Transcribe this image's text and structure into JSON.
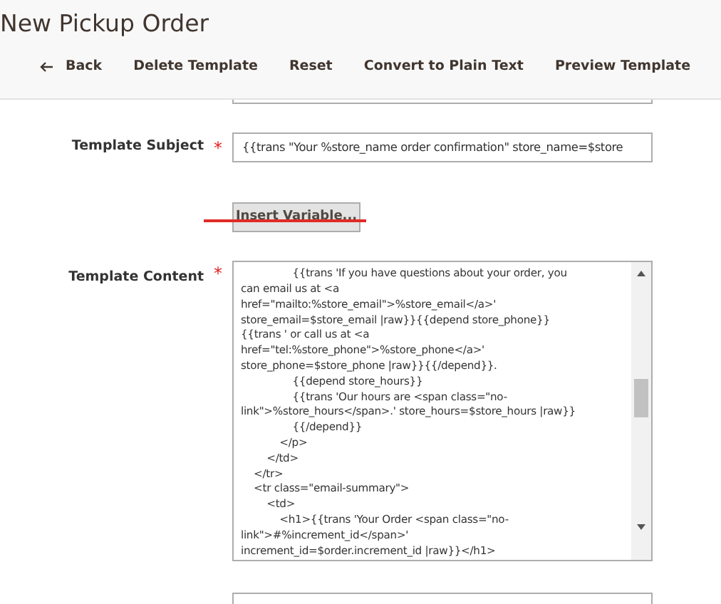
{
  "page_title": "New Pickup Order",
  "toolbar": [
    {
      "kind": "back",
      "label": "Back"
    },
    {
      "kind": "plain",
      "label": "Delete Template"
    },
    {
      "kind": "plain",
      "label": "Reset"
    },
    {
      "kind": "plain",
      "label": "Convert to Plain Text"
    },
    {
      "kind": "plain",
      "label": "Preview Template"
    }
  ],
  "template_subject": {
    "label": "Template Subject",
    "required_mark": "*",
    "value": "{{trans \"Your %store_name order confirmation\" store_name=$store"
  },
  "insert_variable_button": "Insert Variable...",
  "template_content": {
    "label": "Template Content",
    "required_mark": "*",
    "lines": [
      "                {{trans 'If you have questions about your order, you",
      "can email us at <a",
      "href=\"mailto:%store_email\">%store_email</a>'",
      "store_email=$store_email |raw}}{{depend store_phone}}",
      "{{trans ' or call us at <a",
      "href=\"tel:%store_phone\">%store_phone</a>'",
      "store_phone=$store_phone |raw}}{{/depend}}.",
      "                {{depend store_hours}}",
      "                {{trans 'Our hours are <span class=\"no-",
      "link\">%store_hours</span>.' store_hours=$store_hours |raw}}",
      "                {{/depend}}",
      "            </p>",
      "        </td>",
      "    </tr>",
      "    <tr class=\"email-summary\">",
      "        <td>",
      "            <h1>{{trans 'Your Order <span class=\"no-",
      "link\">#%increment_id</span>'",
      "increment_id=$order.increment_id |raw}}</h1>"
    ]
  }
}
